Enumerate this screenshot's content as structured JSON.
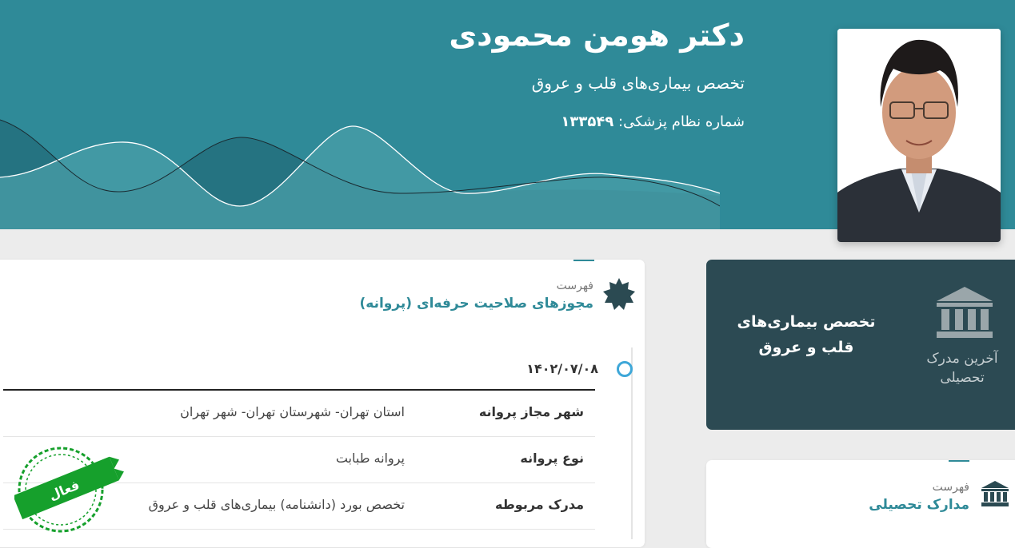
{
  "profile": {
    "name": "دکتر هومن محمودی",
    "specialty": "تخصص بیماری‌های قلب و عروق",
    "medical_number_label": "شماره نظام پزشکی:",
    "medical_number": "۱۳۳۵۴۹"
  },
  "latest_degree": {
    "label": "آخرین مدرک تحصیلی",
    "title": "تخصص بیماری‌های قلب و عروق"
  },
  "licenses": {
    "kicker": "فهرست",
    "title": "مجوزهای صلاحیت حرفه‌ای (پروانه)",
    "date": "۱۴۰۲/۰۷/۰۸",
    "rows": [
      {
        "label": "شهر مجاز پروانه",
        "value": "استان تهران- شهرستان تهران- شهر تهران"
      },
      {
        "label": "نوع پروانه",
        "value": "پروانه طبابت"
      },
      {
        "label": "مدرک مربوطه",
        "value": "تخصص بورد (دانشنامه) بیماری‌های قلب و عروق"
      }
    ],
    "status_stamp": "فعال"
  },
  "education": {
    "kicker": "فهرست",
    "title": "مدارک تحصیلی"
  },
  "colors": {
    "header": "#2f8a98",
    "dark_card": "#2c4a53",
    "accent": "#2f8a98",
    "stamp": "#16a02c",
    "timeline_dot": "#3ea7d8"
  },
  "icons": [
    "bank-icon",
    "badge-icon",
    "bank-small-icon",
    "doctor-photo"
  ]
}
